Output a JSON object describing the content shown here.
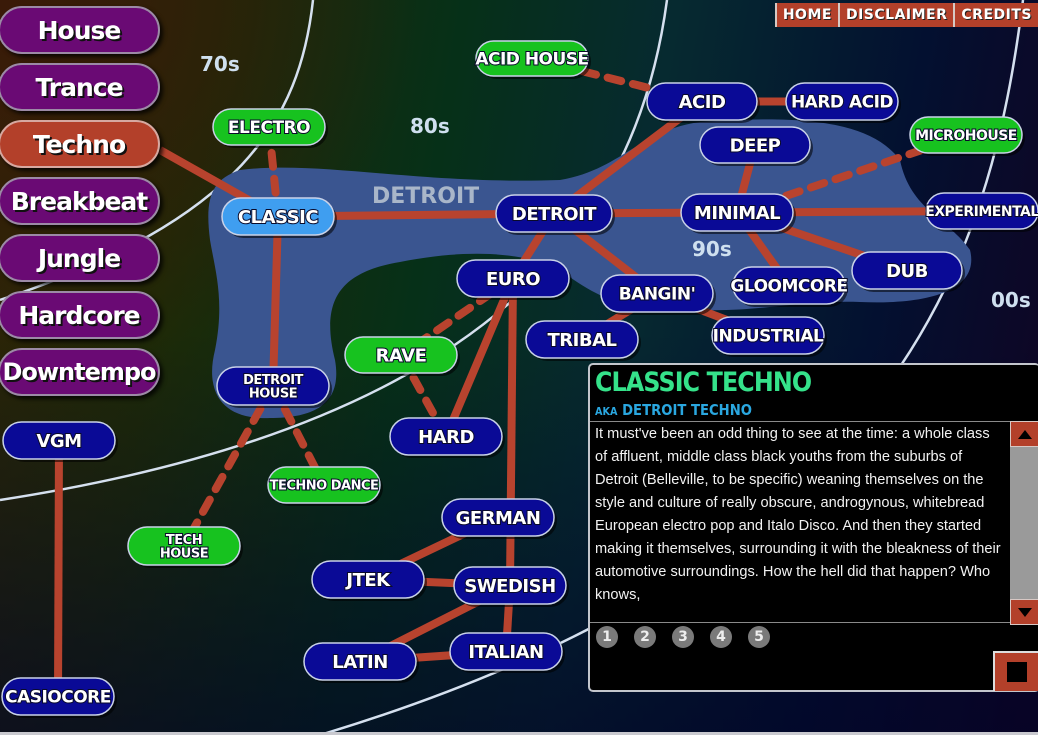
{
  "top_nav": [
    {
      "id": "home",
      "label": "HOME"
    },
    {
      "id": "disclaimer",
      "label": "DISCLAIMER"
    },
    {
      "id": "credits",
      "label": "CREDITS"
    }
  ],
  "genre_menu": [
    {
      "id": "house",
      "label": "House",
      "active": false
    },
    {
      "id": "trance",
      "label": "Trance",
      "active": false
    },
    {
      "id": "techno",
      "label": "Techno",
      "active": true
    },
    {
      "id": "breakbeat",
      "label": "Breakbeat",
      "active": false
    },
    {
      "id": "jungle",
      "label": "Jungle",
      "active": false
    },
    {
      "id": "hardcore",
      "label": "Hardcore",
      "active": false
    },
    {
      "id": "downtempo",
      "label": "Downtempo",
      "active": false
    }
  ],
  "eras": [
    {
      "id": "70s",
      "label": "70s"
    },
    {
      "id": "80s",
      "label": "80s"
    },
    {
      "id": "90s",
      "label": "90s"
    },
    {
      "id": "00s",
      "label": "00s"
    }
  ],
  "region_label": "DETROIT",
  "colors": {
    "subgenre": "#0a0a96",
    "crossover": "#17c21f",
    "selected": "#3f9ef0",
    "active_menu": "#b3402a",
    "menu": "#6a0a74",
    "link": "#b8432e",
    "region": "#3a5590",
    "info_title": "#35e28a",
    "info_aka": "#2aa7e0"
  },
  "nodes": [
    {
      "id": "acid-house",
      "label": "ACID HOUSE",
      "type": "crossover"
    },
    {
      "id": "electro",
      "label": "ELECTRO",
      "type": "crossover"
    },
    {
      "id": "classic",
      "label": "CLASSIC",
      "type": "selected"
    },
    {
      "id": "acid",
      "label": "ACID",
      "type": "subgenre"
    },
    {
      "id": "hard-acid",
      "label": "HARD ACID",
      "type": "subgenre"
    },
    {
      "id": "deep",
      "label": "DEEP",
      "type": "subgenre"
    },
    {
      "id": "microhouse",
      "label": "MICROHOUSE",
      "type": "crossover"
    },
    {
      "id": "detroit",
      "label": "DETROIT",
      "type": "subgenre"
    },
    {
      "id": "minimal",
      "label": "MINIMAL",
      "type": "subgenre"
    },
    {
      "id": "experimental",
      "label": "EXPERIMENTAL",
      "type": "subgenre"
    },
    {
      "id": "euro",
      "label": "EURO",
      "type": "subgenre"
    },
    {
      "id": "bangin",
      "label": "BANGIN'",
      "type": "subgenre"
    },
    {
      "id": "gloomcore",
      "label": "GLOOMCORE",
      "type": "subgenre"
    },
    {
      "id": "dub",
      "label": "DUB",
      "type": "subgenre"
    },
    {
      "id": "tribal",
      "label": "TRIBAL",
      "type": "subgenre"
    },
    {
      "id": "industrial",
      "label": "INDUSTRIAL",
      "type": "subgenre"
    },
    {
      "id": "rave",
      "label": "RAVE",
      "type": "crossover"
    },
    {
      "id": "detroit-house",
      "label": "DETROIT\nHOUSE",
      "type": "subgenre"
    },
    {
      "id": "hard",
      "label": "HARD",
      "type": "subgenre"
    },
    {
      "id": "vgm",
      "label": "VGM",
      "type": "subgenre"
    },
    {
      "id": "techno-dance",
      "label": "TECHNO DANCE",
      "type": "crossover"
    },
    {
      "id": "tech-house",
      "label": "TECH\nHOUSE",
      "type": "crossover"
    },
    {
      "id": "german",
      "label": "GERMAN",
      "type": "subgenre"
    },
    {
      "id": "jtek",
      "label": "JTEK",
      "type": "subgenre"
    },
    {
      "id": "swedish",
      "label": "SWEDISH",
      "type": "subgenre"
    },
    {
      "id": "latin",
      "label": "LATIN",
      "type": "subgenre"
    },
    {
      "id": "italian",
      "label": "ITALIAN",
      "type": "subgenre"
    },
    {
      "id": "casiocore",
      "label": "CASIOCORE",
      "type": "subgenre"
    }
  ],
  "links": [
    {
      "from": "techno-menu",
      "to": "classic",
      "style": "solid"
    },
    {
      "from": "electro",
      "to": "classic",
      "style": "dashed"
    },
    {
      "from": "classic",
      "to": "detroit",
      "style": "solid"
    },
    {
      "from": "classic",
      "to": "detroit-house",
      "style": "solid"
    },
    {
      "from": "acid-house",
      "to": "acid",
      "style": "dashed"
    },
    {
      "from": "acid",
      "to": "hard-acid",
      "style": "solid"
    },
    {
      "from": "detroit",
      "to": "acid",
      "style": "solid"
    },
    {
      "from": "detroit",
      "to": "minimal",
      "style": "solid"
    },
    {
      "from": "deep",
      "to": "minimal",
      "style": "solid"
    },
    {
      "from": "minimal",
      "to": "microhouse",
      "style": "dashed"
    },
    {
      "from": "minimal",
      "to": "experimental",
      "style": "solid"
    },
    {
      "from": "minimal",
      "to": "gloomcore",
      "style": "solid"
    },
    {
      "from": "minimal",
      "to": "dub",
      "style": "solid"
    },
    {
      "from": "detroit",
      "to": "euro",
      "style": "solid"
    },
    {
      "from": "detroit",
      "to": "bangin",
      "style": "solid"
    },
    {
      "from": "bangin",
      "to": "tribal",
      "style": "solid"
    },
    {
      "from": "bangin",
      "to": "industrial",
      "style": "solid"
    },
    {
      "from": "euro",
      "to": "rave",
      "style": "dashed"
    },
    {
      "from": "rave",
      "to": "hard",
      "style": "dashed"
    },
    {
      "from": "euro",
      "to": "hard",
      "style": "solid"
    },
    {
      "from": "euro",
      "to": "swedish",
      "style": "solid"
    },
    {
      "from": "detroit-house",
      "to": "tech-house",
      "style": "dashed"
    },
    {
      "from": "detroit-house",
      "to": "techno-dance",
      "style": "dashed"
    },
    {
      "from": "german",
      "to": "jtek",
      "style": "solid"
    },
    {
      "from": "jtek",
      "to": "swedish",
      "style": "solid"
    },
    {
      "from": "swedish",
      "to": "latin",
      "style": "solid"
    },
    {
      "from": "latin",
      "to": "italian",
      "style": "solid"
    },
    {
      "from": "swedish",
      "to": "italian",
      "style": "solid"
    },
    {
      "from": "vgm",
      "to": "casiocore",
      "style": "solid"
    }
  ],
  "info_panel": {
    "title": "CLASSIC TECHNO",
    "aka_prefix": "AKA",
    "aka": "DETROIT TECHNO",
    "text": "It must've been an odd thing to see at the time: a whole class of affluent, middle class black youths from the suburbs of Detroit (Belleville, to be specific) weaning themselves on the style and culture of really obscure, androgynous, whitebread European electro pop and Italo Disco. And then they started making it themselves, surrounding it with the bleakness of their automotive surroundings. How the hell did that happen? Who knows,",
    "pages": [
      "1",
      "2",
      "3",
      "4",
      "5"
    ],
    "current_page": "1",
    "scroll_up_icon": "arrow-up",
    "scroll_down_icon": "arrow-down",
    "stop_icon": "stop-square"
  }
}
